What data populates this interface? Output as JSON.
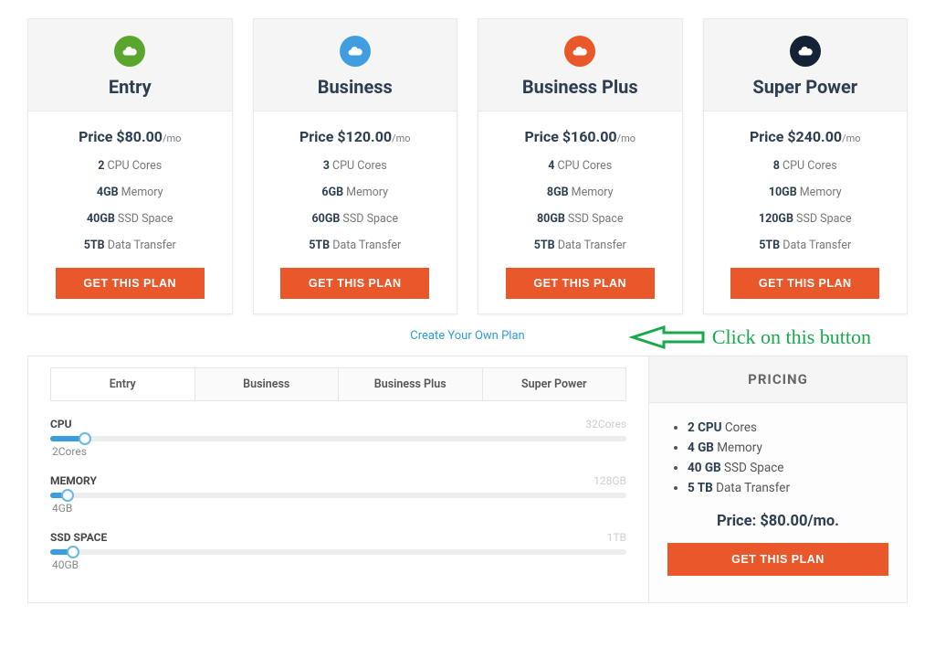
{
  "plans": [
    {
      "name": "Entry",
      "icon_color": "#5aa52e",
      "price_prefix": "Price ",
      "price_amount": "$80.00",
      "price_suffix": "/mo",
      "cpu_b": "2",
      "cpu_t": " CPU Cores",
      "mem_b": "4GB",
      "mem_t": " Memory",
      "ssd_b": "40GB",
      "ssd_t": " SSD Space",
      "dt_b": "5TB",
      "dt_t": " Data Transfer",
      "button": "GET THIS PLAN"
    },
    {
      "name": "Business",
      "icon_color": "#3f9de0",
      "price_prefix": "Price ",
      "price_amount": "$120.00",
      "price_suffix": "/mo",
      "cpu_b": "3",
      "cpu_t": " CPU Cores",
      "mem_b": "6GB",
      "mem_t": " Memory",
      "ssd_b": "60GB",
      "ssd_t": " SSD Space",
      "dt_b": "5TB",
      "dt_t": " Data Transfer",
      "button": "GET THIS PLAN"
    },
    {
      "name": "Business Plus",
      "icon_color": "#e8582b",
      "price_prefix": "Price ",
      "price_amount": "$160.00",
      "price_suffix": "/mo",
      "cpu_b": "4",
      "cpu_t": " CPU Cores",
      "mem_b": "8GB",
      "mem_t": " Memory",
      "ssd_b": "80GB",
      "ssd_t": " SSD Space",
      "dt_b": "5TB",
      "dt_t": " Data Transfer",
      "button": "GET THIS PLAN"
    },
    {
      "name": "Super Power",
      "icon_color": "#132235",
      "price_prefix": "Price ",
      "price_amount": "$240.00",
      "price_suffix": "/mo",
      "cpu_b": "8",
      "cpu_t": " CPU Cores",
      "mem_b": "10GB",
      "mem_t": " Memory",
      "ssd_b": "120GB",
      "ssd_t": " SSD Space",
      "dt_b": "5TB",
      "dt_t": " Data Transfer",
      "button": "GET THIS PLAN"
    }
  ],
  "create_link": "Create Your Own Plan",
  "annotation_text": "Click on this button",
  "builder": {
    "tabs": [
      "Entry",
      "Business",
      "Business Plus",
      "Super Power"
    ],
    "active_tab": 0,
    "sliders": {
      "cpu": {
        "label": "CPU",
        "max": "32Cores",
        "value": "2Cores",
        "pct": 6
      },
      "mem": {
        "label": "MEMORY",
        "max": "128GB",
        "value": "4GB",
        "pct": 3
      },
      "ssd": {
        "label": "SSD SPACE",
        "max": "1TB",
        "value": "40GB",
        "pct": 4
      }
    },
    "pricing": {
      "heading": "PRICING",
      "items": [
        {
          "b": "2 CPU",
          "t": " Cores"
        },
        {
          "b": "4 GB",
          "t": " Memory"
        },
        {
          "b": "40 GB",
          "t": " SSD Space"
        },
        {
          "b": "5 TB",
          "t": " Data Transfer"
        }
      ],
      "total_label": "Price: ",
      "total_value": "$80.00/mo.",
      "button": "GET THIS PLAN"
    }
  }
}
